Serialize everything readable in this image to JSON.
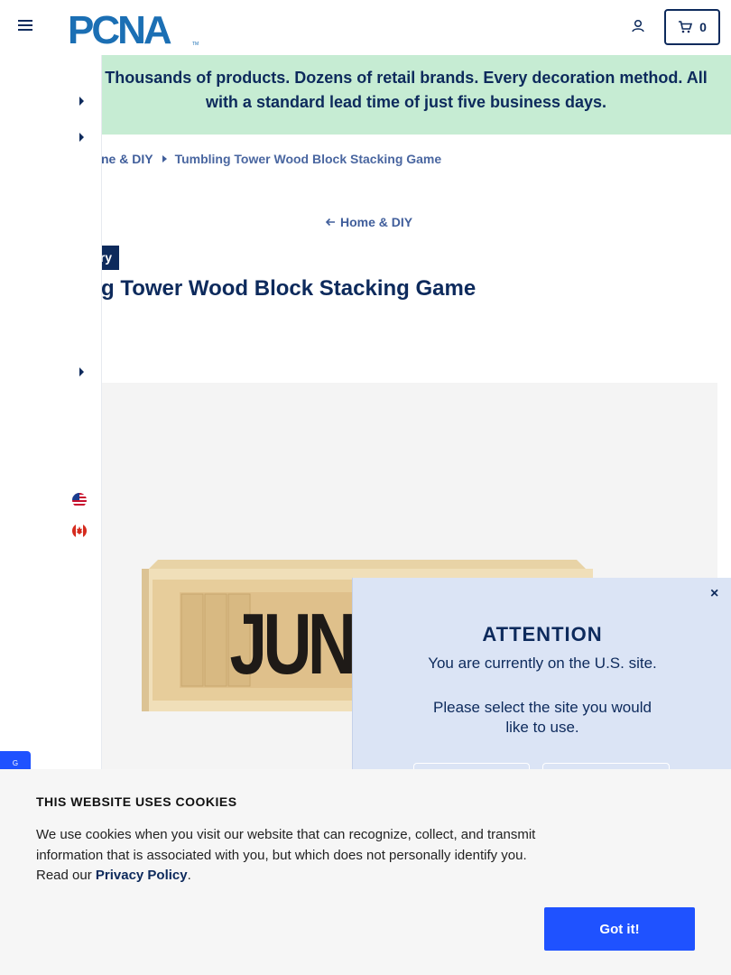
{
  "header": {
    "logo_text": "PCNA",
    "logo_tm": "TM",
    "cart_count": "0"
  },
  "banner": {
    "text_line1": "Thousands of products. Dozens of retail brands. Every decoration method. All",
    "text_line2": "with a standard lead time of just five business days."
  },
  "breadcrumb": {
    "parent": "ne & DIY",
    "current": "Tumbling Tower Wood Block Stacking Game"
  },
  "back_link": {
    "label": "Home & DIY"
  },
  "product": {
    "category_badge": "ry",
    "title": "g Tower Wood Block Stacking Game",
    "box_print": "JUNCT"
  },
  "site_popup": {
    "close": "×",
    "title": "ATTENTION",
    "line1": "You are currently on the U.S. site.",
    "line2": "Please select the site you would",
    "line3": "like to use."
  },
  "cookie": {
    "title": "THIS WEBSITE USES COOKIES",
    "text": "We use cookies when you visit our website that can recognize, collect, and transmit information that is associated with you, but which does not personally identify you. Read our ",
    "link": "Privacy Policy",
    "period": ".",
    "button": "Got it!"
  },
  "feedback_tab": {
    "label": "G"
  },
  "colors": {
    "navy": "#0d2a5c",
    "banner_green": "#c6ecd3",
    "popup_blue": "#dbe4f5",
    "accent_blue": "#1f52ff"
  }
}
